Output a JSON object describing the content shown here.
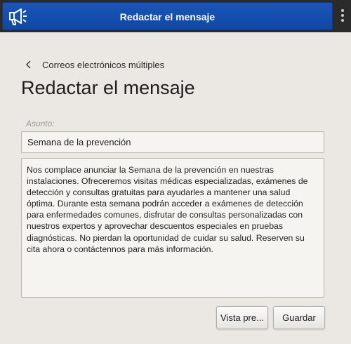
{
  "header": {
    "title": "Redactar el mensaje",
    "app_icon": "megaphone-icon",
    "menu_icon": "more-vertical-icon"
  },
  "breadcrumb": {
    "label": "Correos electrónicos múltiples",
    "icon": "chevron-left-icon"
  },
  "page": {
    "title": "Redactar el mensaje"
  },
  "form": {
    "subject_label": "Asunto:",
    "subject_value": "Semana de la prevención",
    "body_value": "Nos complace anunciar la Semana de la prevención en nuestras instalaciones. Ofreceremos visitas médicas especializadas, exámenes de detección y consultas gratuitas para ayudarles a mantener una salud óptima. Durante esta semana podrán acceder a exámenes de detección para enfermedades comunes, disfrutar de consultas personalizadas con nuestros expertos y aprovechar descuentos especiales en pruebas diagnósticas. No pierdan la oportunidad de cuidar su salud. Reserven su cita ahora o contáctennos para más información."
  },
  "actions": {
    "preview_label": "Vista pre...",
    "save_label": "Guardar"
  },
  "colors": {
    "titlebar": "#1252b0",
    "background": "#ebe8e3",
    "field_background": "#f5f4f1"
  }
}
